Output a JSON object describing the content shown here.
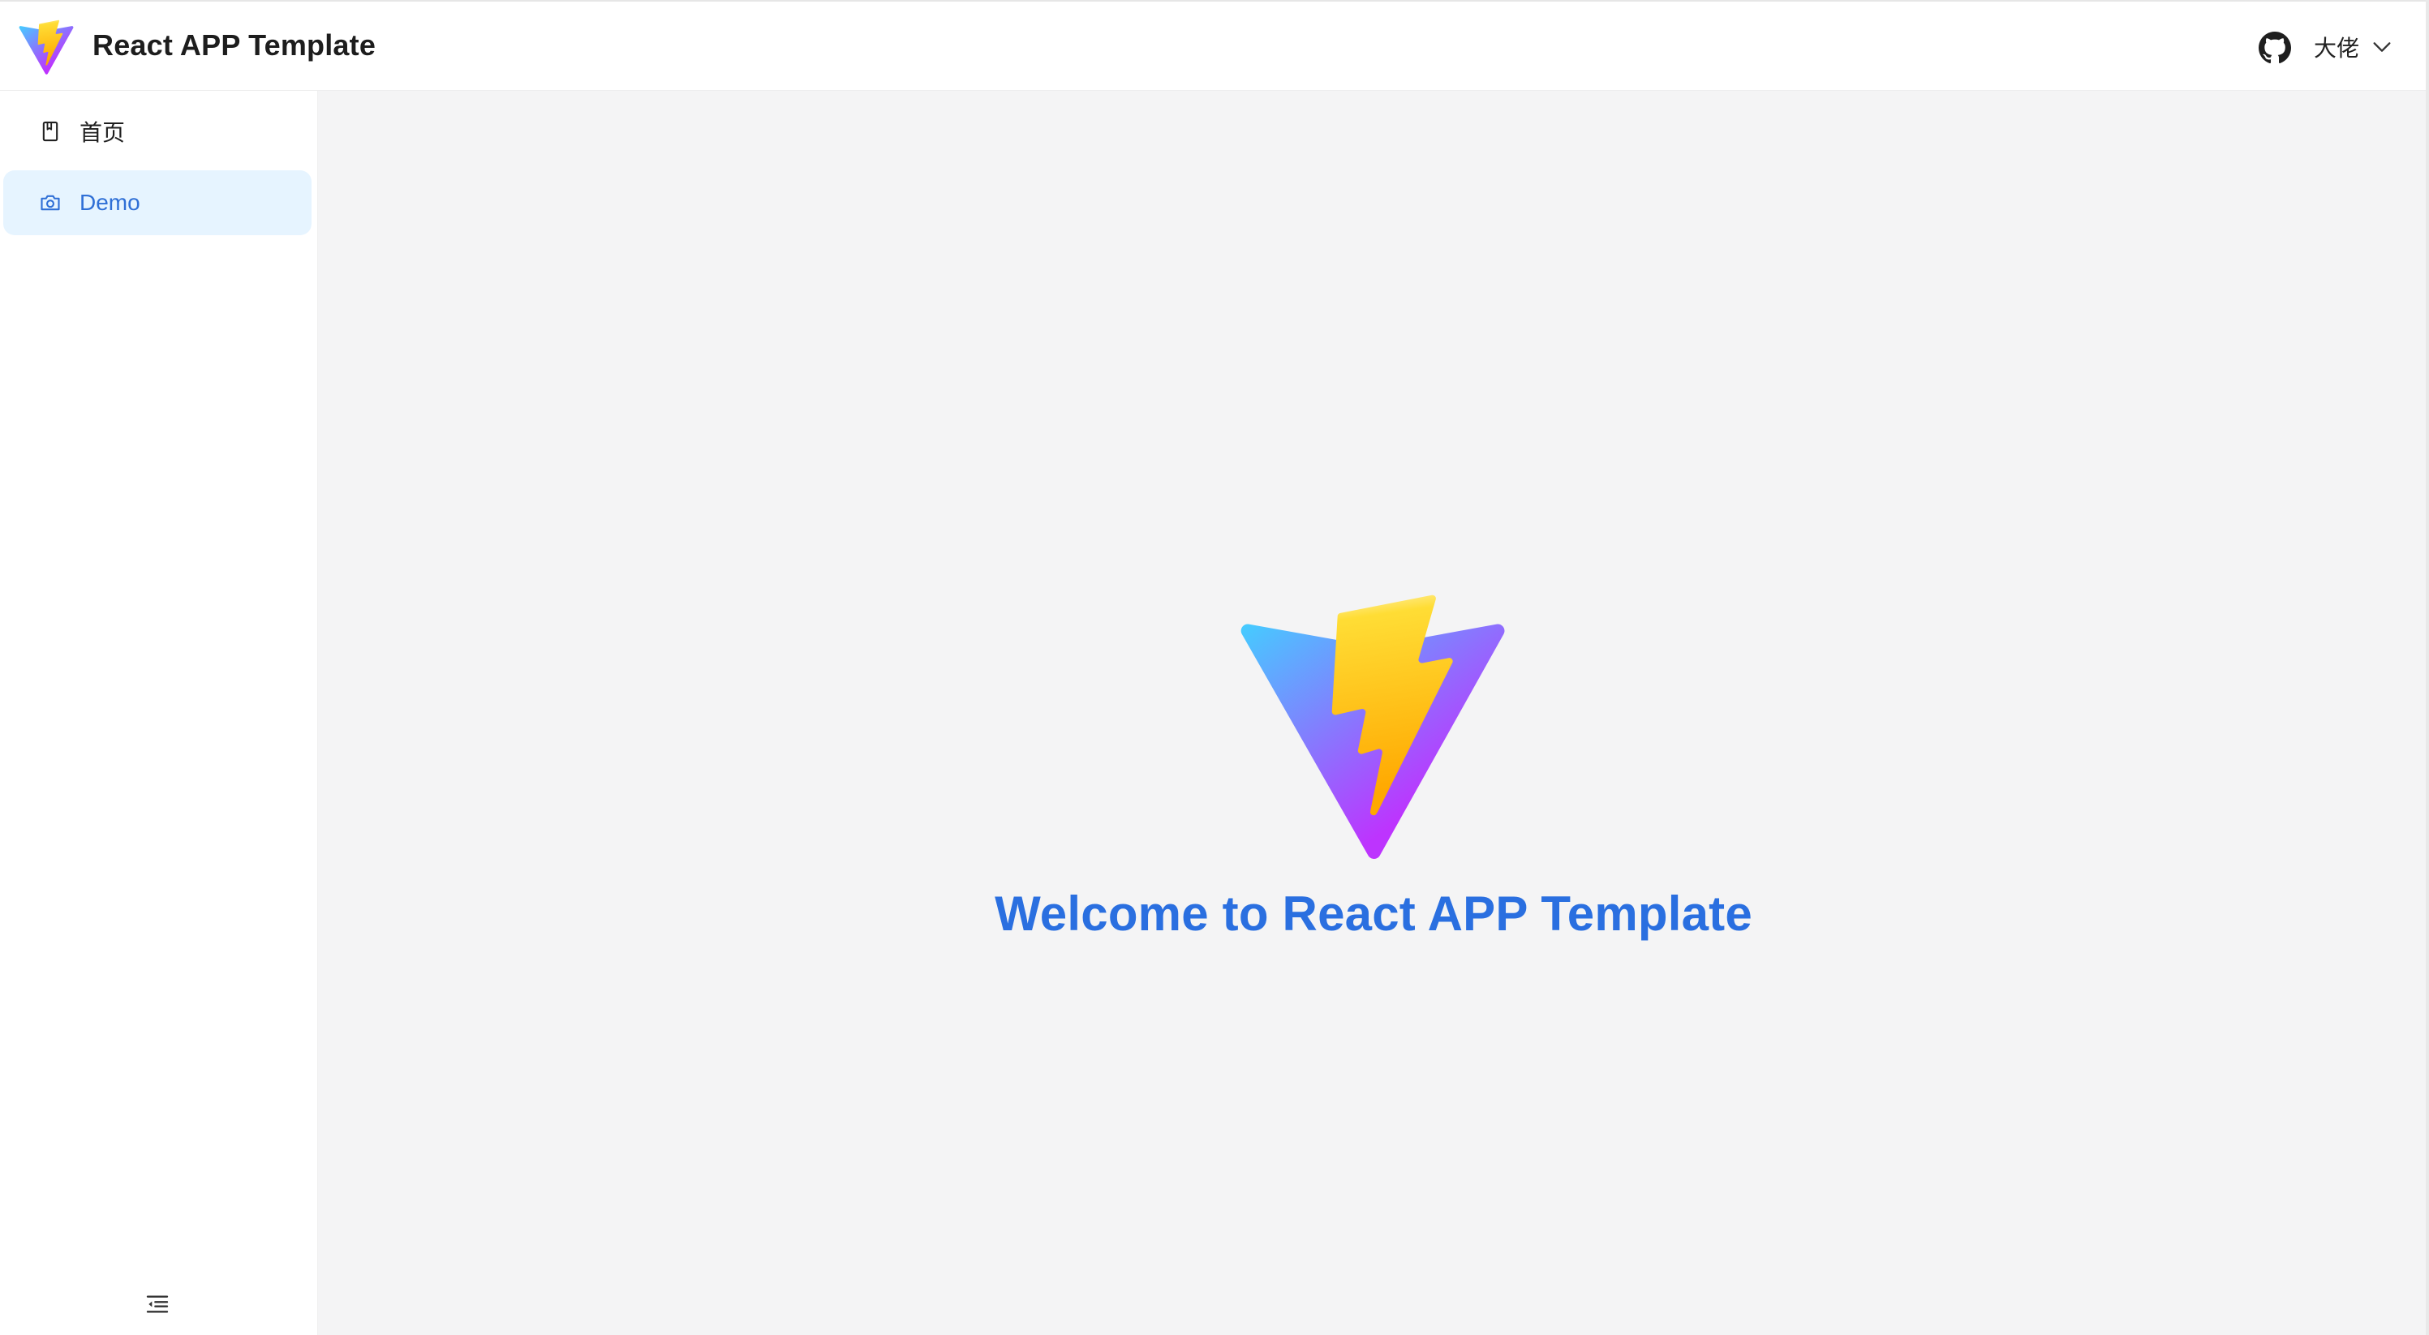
{
  "header": {
    "app_title": "React APP Template",
    "user_name": "大佬"
  },
  "sidebar": {
    "items": [
      {
        "label": "首页",
        "icon": "book-icon",
        "active": false
      },
      {
        "label": "Demo",
        "icon": "camera-icon",
        "active": true
      }
    ],
    "collapse_icon": "menu-fold-icon"
  },
  "main": {
    "welcome_text": "Welcome to React APP Template",
    "hero_icon": "vite-logo-icon"
  },
  "colors": {
    "accent": "#2a6fe0",
    "active_item_bg": "#e6f4ff",
    "main_bg": "#f4f4f5"
  }
}
